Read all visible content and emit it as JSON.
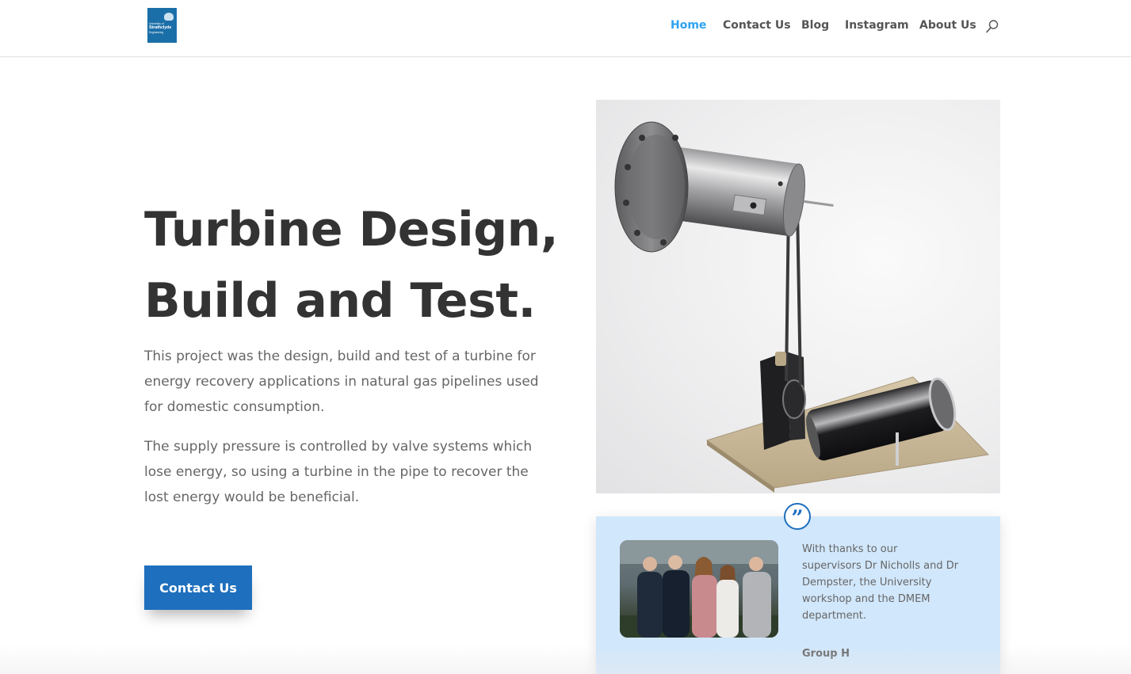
{
  "header": {
    "logo": {
      "line1": "University of",
      "line2": "Strathclyde",
      "line3": "Engineering"
    },
    "nav": [
      {
        "label": "Home",
        "active": true
      },
      {
        "label": "Contact Us",
        "active": false
      },
      {
        "label": "Blog",
        "active": false
      },
      {
        "label": "Instagram",
        "active": false
      },
      {
        "label": "About Us",
        "active": false
      }
    ],
    "search_icon": "search-icon"
  },
  "hero": {
    "title_line1": "Turbine Design,",
    "title_line2": "Build and Test.",
    "paragraph1": "This project was the design, build and test of a turbine for energy recovery applications in natural gas pipelines used for domestic consumption.",
    "paragraph2": "The supply pressure is controlled by valve systems which lose energy, so using a turbine in the pipe to recover the lost energy would be beneficial.",
    "cta_label": "Contact Us"
  },
  "testimonial": {
    "quote_icon": "quote-icon",
    "text": " With thanks to our\nsupervisors Dr Nicholls and Dr\nDempster, the University\nworkshop and the DMEM\ndepartment.",
    "author": "Group H"
  },
  "colors": {
    "accent": "#2ea3f2",
    "button": "#1e6fbd",
    "testimonial_bg": "#d1e7fb",
    "logo_bg": "#1b6fa8"
  }
}
